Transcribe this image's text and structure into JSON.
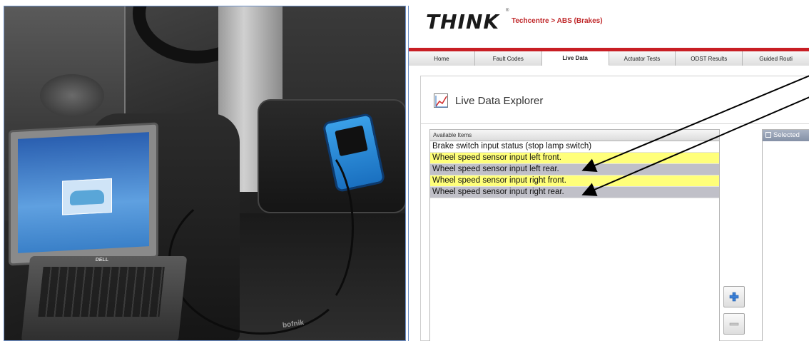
{
  "photo": {
    "laptop_brand": "DELL",
    "mat_brand": "bofnik"
  },
  "app": {
    "logo": "THINK",
    "logo_reg": "®",
    "breadcrumb": "Techcentre > ABS (Brakes)",
    "accent_color": "#c81e24"
  },
  "tabs": [
    {
      "label": "Home",
      "active": false
    },
    {
      "label": "Fault Codes",
      "active": false
    },
    {
      "label": "Live Data",
      "active": true
    },
    {
      "label": "Actuator Tests",
      "active": false
    },
    {
      "label": "ODST Results",
      "active": false
    },
    {
      "label": "Guided Routi",
      "active": false
    }
  ],
  "explorer": {
    "title": "Live Data Explorer",
    "icon": "line-chart-icon"
  },
  "available": {
    "header": "Available Items",
    "items": [
      {
        "label": "Brake switch input status (stop lamp switch)",
        "highlight": "none"
      },
      {
        "label": "Wheel speed sensor input left front.",
        "highlight": "yellow"
      },
      {
        "label": "Wheel speed sensor input left rear.",
        "highlight": "grey"
      },
      {
        "label": "Wheel speed sensor input right front.",
        "highlight": "yellow"
      },
      {
        "label": "Wheel speed sensor input right rear.",
        "highlight": "grey"
      }
    ]
  },
  "selected": {
    "header": "Selected"
  },
  "buttons": {
    "add_icon": "plus-icon",
    "remove_icon": "minus-icon"
  }
}
